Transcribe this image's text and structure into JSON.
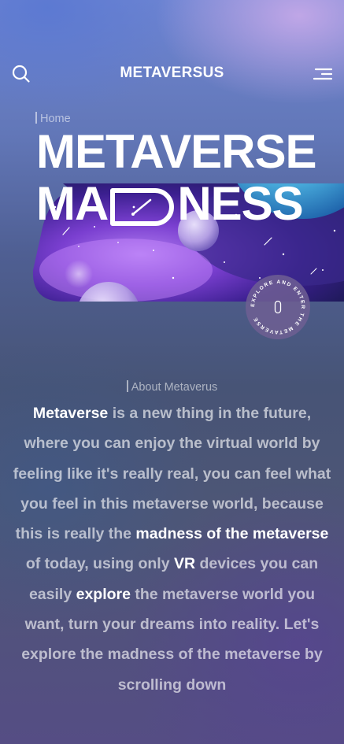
{
  "header": {
    "title": "METAVERSUS",
    "search_icon": "search-icon",
    "menu_icon": "menu-icon"
  },
  "hero": {
    "breadcrumb": "Home",
    "title_line1": "METAVERSE",
    "title_line2_start": "MA",
    "title_line2_end": "NESS",
    "badge_text": "EXPLORE AND ENTER THE METAVERSE",
    "badge_digit": "0"
  },
  "about": {
    "label": "About Metaverus",
    "segments": [
      {
        "text": "Metaverse",
        "highlight": true
      },
      {
        "text": " is a new thing in the future, where you can enjoy the virtual world by feeling like it's really real, you can feel what you feel in this metaverse world, because this is really the ",
        "highlight": false
      },
      {
        "text": "madness of the metaverse",
        "highlight": true
      },
      {
        "text": " of today, using only ",
        "highlight": false
      },
      {
        "text": "VR",
        "highlight": true
      },
      {
        "text": " devices you can easily ",
        "highlight": false
      },
      {
        "text": "explore",
        "highlight": true
      },
      {
        "text": " the metaverse world you want, turn your dreams into reality. Let's explore the madness of the metaverse by scrolling down",
        "highlight": false
      }
    ]
  },
  "colors": {
    "text": "#ffffff",
    "muted": "rgba(255,255,255,0.6)",
    "accent_purple": "#7b4fd6",
    "accent_cyan": "#5fc3e6"
  }
}
